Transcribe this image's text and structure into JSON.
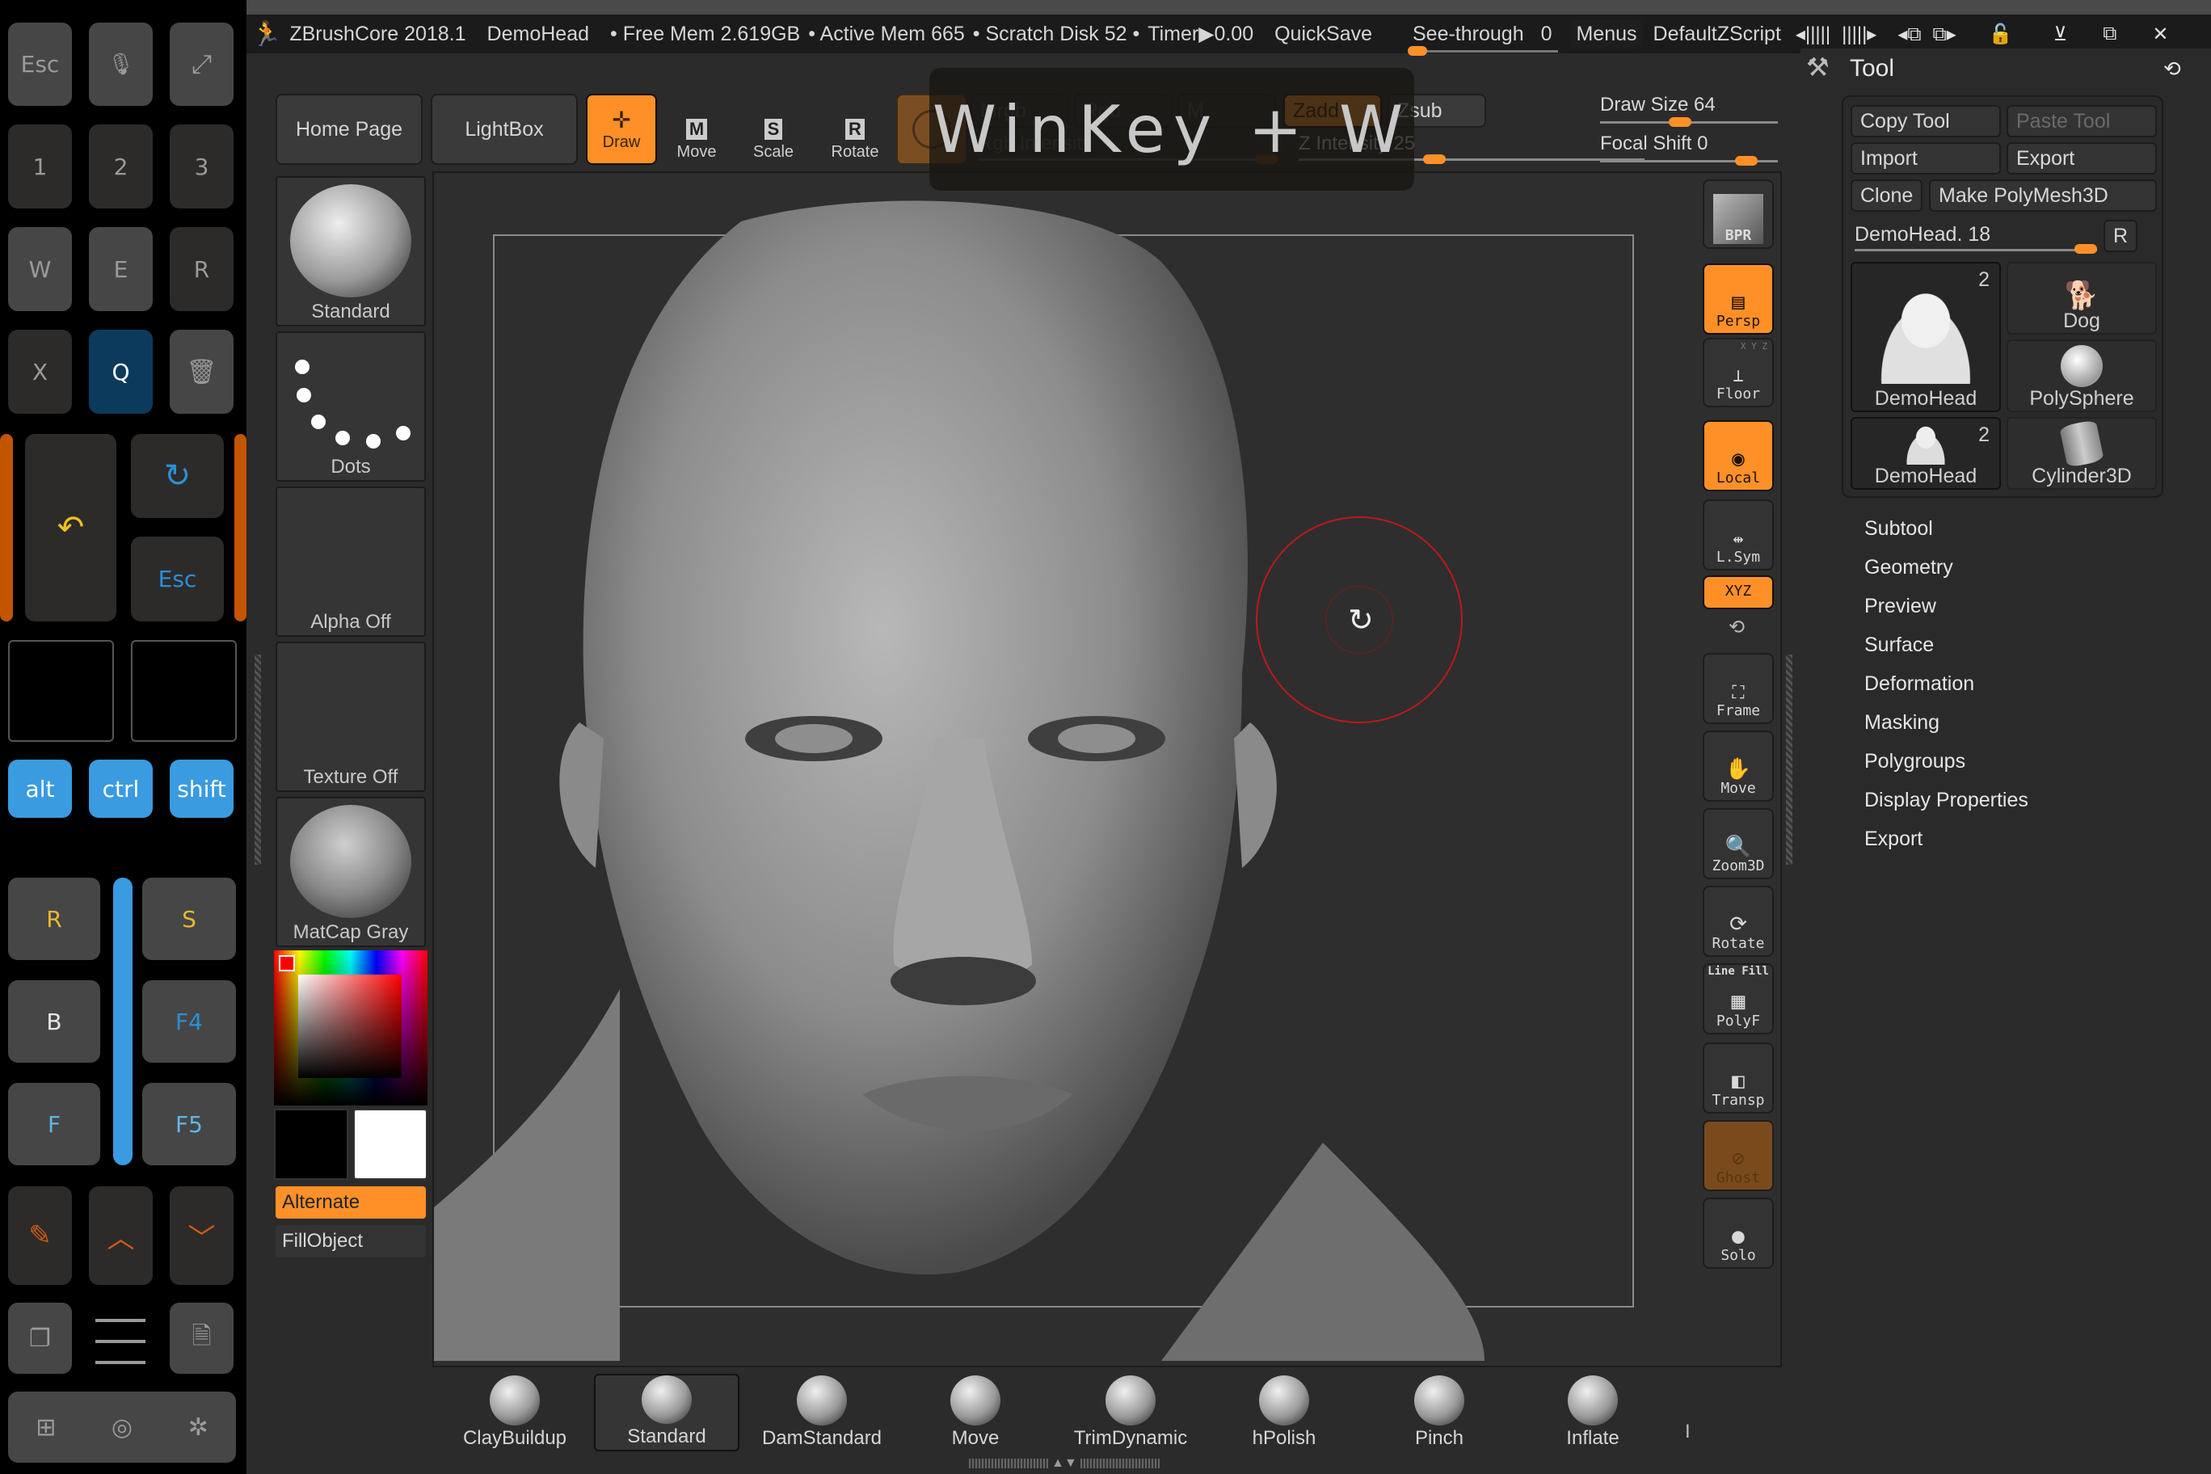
{
  "keypad": {
    "row1": [
      "Esc",
      "mic-icon",
      "expand-icon"
    ],
    "row2": [
      "1",
      "2",
      "3"
    ],
    "row3": [
      "W",
      "E",
      "R"
    ],
    "row4": [
      "X",
      "Q",
      "trash-icon"
    ],
    "undo_icon": "undo-icon",
    "redo_icon": "redo-icon",
    "esc2": "Esc",
    "modifiers": [
      "alt",
      "ctrl",
      "shift"
    ],
    "left_col": [
      "R",
      "B",
      "F"
    ],
    "right_col": [
      "S",
      "F4",
      "F5"
    ],
    "nav": [
      "pencil-icon",
      "chevron-up-icon",
      "chevron-down-icon"
    ],
    "utility": [
      "copy-icon",
      "menu-icon",
      "document-icon"
    ],
    "system": [
      "windows-icon",
      "camera-icon",
      "settings-icon"
    ],
    "colors": {
      "r": "#e8b830",
      "s": "#e8b830",
      "b": "#e6e6e6",
      "f4": "#2b8fd8",
      "f": "#5fb6e8",
      "f5": "#5fb6e8",
      "q_bg": "#0c3a5c",
      "modifier_bg": "#3a9be0",
      "accent_orange": "#c45500"
    }
  },
  "titlebar": {
    "app": "ZBrushCore 2018.1",
    "document": "DemoHead",
    "free_mem": "• Free Mem 2.619GB",
    "active_mem": "• Active Mem 665",
    "scratch": "• Scratch Disk 52 •",
    "timer": "Timer▶0.00",
    "quicksave": "QuickSave",
    "see_through_label": "See-through",
    "see_through_value": "0",
    "menus": "Menus",
    "script": "DefaultZScript",
    "window_controls": [
      "minimize-icon",
      "restore-icon",
      "close-icon"
    ]
  },
  "toolbar": {
    "home": "Home Page",
    "lightbox": "LightBox",
    "draw": "Draw",
    "move": "Move",
    "scale": "Scale",
    "rotate": "Rotate",
    "mrgb": "Mrgb",
    "rgb": "Rgb",
    "m": "M",
    "zadd": "Zadd",
    "zsub": "Zsub",
    "rgb_intensity": "Rgb Intensity",
    "z_intensity_label": "Z Intensity",
    "z_intensity_value": "25",
    "draw_size_label": "Draw Size",
    "draw_size_value": "64",
    "focal_shift_label": "Focal Shift",
    "focal_shift_value": "0",
    "accent": "#ff9028"
  },
  "overlay": {
    "text": "WinKey + W"
  },
  "left_panel": {
    "brush": "Standard",
    "stroke": "Dots",
    "alpha": "Alpha Off",
    "texture": "Texture Off",
    "material": "MatCap Gray",
    "alternate": "Alternate",
    "fill": "FillObject",
    "main_color": "#000000",
    "secondary_color": "#ffffff"
  },
  "shelf": [
    "BPR",
    "Persp",
    "Floor",
    "Local",
    "L.Sym",
    "XYZ",
    "Frame",
    "Move",
    "Zoom3D",
    "Rotate",
    "PolyF",
    "Transp",
    "Ghost",
    "Solo"
  ],
  "shelf_extra": {
    "floor_axes": "X Y Z",
    "line_fill": "Line Fill"
  },
  "tool": {
    "title": "Tool",
    "copy": "Copy Tool",
    "paste": "Paste Tool",
    "import": "Import",
    "export": "Export",
    "clone": "Clone",
    "make_polymesh": "Make PolyMesh3D",
    "current_label": "DemoHead. 18",
    "r": "R",
    "thumbs": [
      {
        "label": "DemoHead",
        "count": "2"
      },
      {
        "label": "Dog",
        "count": ""
      },
      {
        "label": "PolySphere",
        "count": ""
      },
      {
        "label": "DemoHead",
        "count": "2"
      },
      {
        "label": "Cylinder3D",
        "count": ""
      }
    ],
    "submenus": [
      "Subtool",
      "Geometry",
      "Preview",
      "Surface",
      "Deformation",
      "Masking",
      "Polygroups",
      "Display Properties",
      "Export"
    ]
  },
  "brushbar": {
    "brushes": [
      "ClayBuildup",
      "Standard",
      "DamStandard",
      "Move",
      "TrimDynamic",
      "hPolish",
      "Pinch",
      "Inflate"
    ],
    "selected": "Standard",
    "more": "I"
  }
}
